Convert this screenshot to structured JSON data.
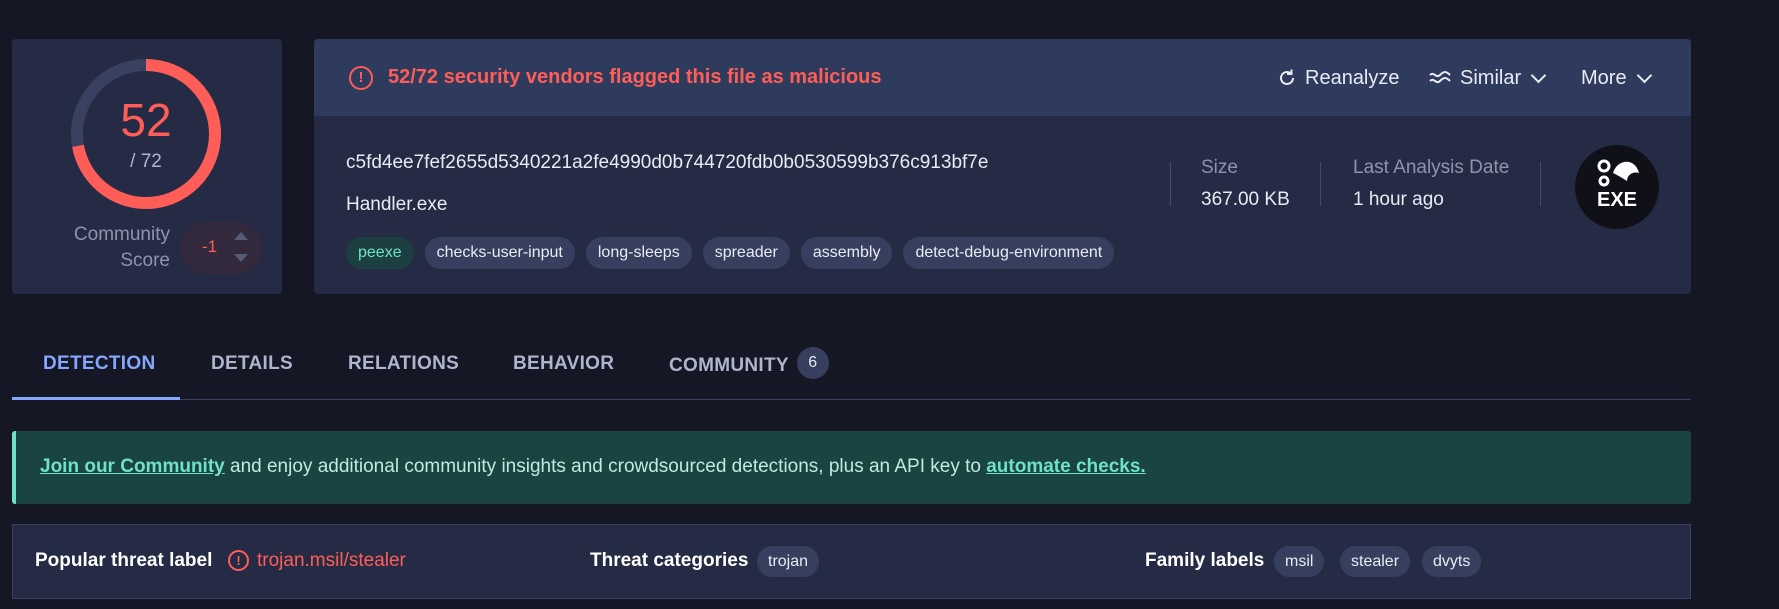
{
  "score": {
    "detections": "52",
    "total": "/ 72",
    "detections_value": 52,
    "total_value": 72,
    "community_label_1": "Community",
    "community_label_2": "Score",
    "community_value": "-1",
    "ring_color": "#ff5d57",
    "ring_bg_color": "#3a4160"
  },
  "alert": {
    "icon": "exclamation-circle-icon",
    "text": "52/72 security vendors flagged this file as malicious",
    "color": "#ff5d57"
  },
  "actions": {
    "reanalyze": "Reanalyze",
    "similar": "Similar",
    "more": "More"
  },
  "file": {
    "hash": "c5fd4ee7fef2655d5340221a2fe4990d0b744720fdb0b0530599b376c913bf7e",
    "name": "Handler.exe",
    "tags": [
      "peexe",
      "checks-user-input",
      "long-sleeps",
      "spreader",
      "assembly",
      "detect-debug-environment"
    ],
    "size_label": "Size",
    "size_value": "367.00 KB",
    "date_label": "Last Analysis Date",
    "date_value": "1 hour ago",
    "type_badge": "EXE"
  },
  "tabs": {
    "detection": "DETECTION",
    "details": "DETAILS",
    "relations": "RELATIONS",
    "behavior": "BEHAVIOR",
    "community": "COMMUNITY",
    "community_count": "6",
    "active_color": "#86a7ff"
  },
  "banner": {
    "link1": "Join our Community",
    "middle": " and enjoy additional community insights and crowdsourced detections, plus an API key to ",
    "link2": "automate checks."
  },
  "threat": {
    "popular_label": "Popular threat label",
    "popular_value": "trojan.msil/stealer",
    "categories_label": "Threat categories",
    "categories": [
      "trojan"
    ],
    "family_label": "Family labels",
    "families": [
      "msil",
      "stealer",
      "dvyts"
    ]
  }
}
